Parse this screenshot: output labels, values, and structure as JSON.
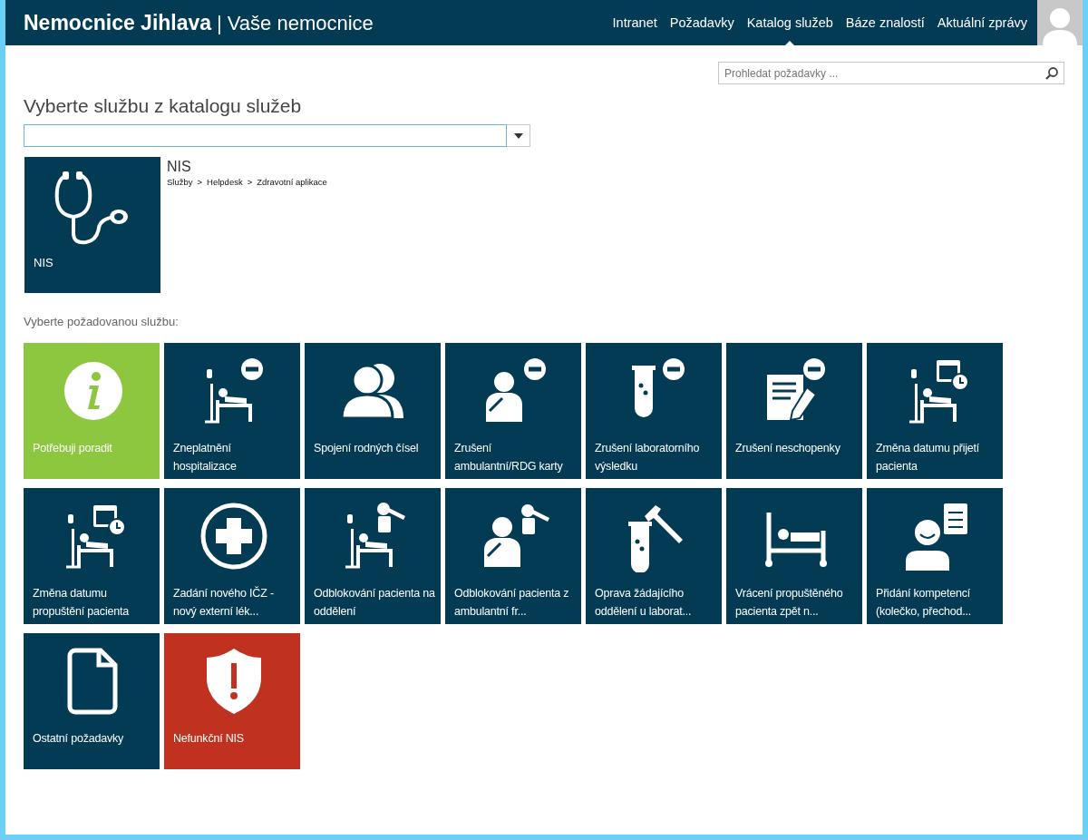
{
  "header": {
    "brand": "Nemocnice Jihlava",
    "separator": "|",
    "tagline": "Vaše nemocnice",
    "nav": [
      {
        "label": "Intranet",
        "selected": false
      },
      {
        "label": "Požadavky",
        "selected": false
      },
      {
        "label": "Katalog služeb",
        "selected": true
      },
      {
        "label": "Báze znalostí",
        "selected": false
      },
      {
        "label": "Aktuální zprávy",
        "selected": false
      }
    ]
  },
  "request_search": {
    "placeholder": "Prohledat požadavky ..."
  },
  "heading": "Vyberte službu z katalogu služeb",
  "selected_service": {
    "tile_label": "NIS",
    "title": "NIS",
    "breadcrumb": [
      "Služby",
      "Helpdesk",
      "Zdravotní aplikace"
    ],
    "separator": ">"
  },
  "services_label": "Vyberte požadovanou službu:",
  "services": [
    {
      "label": "Potřebuji poradit",
      "kind": "info",
      "color": "#8dc63f"
    },
    {
      "label": "Zneplatnění hospitalizace",
      "kind": "bed-minus",
      "color": "#033a54"
    },
    {
      "label": "Spojení rodných čísel",
      "kind": "people",
      "color": "#033a54"
    },
    {
      "label": "Zrušení ambulantní/RDG karty",
      "kind": "patient-minus",
      "color": "#033a54"
    },
    {
      "label": "Zrušení laboratorního výsledku",
      "kind": "tube-minus",
      "color": "#033a54"
    },
    {
      "label": "Zrušení neschopenky",
      "kind": "form-minus",
      "color": "#033a54"
    },
    {
      "label": "Změna datumu přijetí pacienta",
      "kind": "bed-calendar",
      "color": "#033a54"
    },
    {
      "label": "Změna datumu propuštění pacienta",
      "kind": "bed-calendar",
      "color": "#033a54"
    },
    {
      "label": "Zadání nového IČZ - nový externí lék...",
      "kind": "cross",
      "color": "#033a54"
    },
    {
      "label": "Odblokování pacienta na oddělení",
      "kind": "bed-key",
      "color": "#033a54"
    },
    {
      "label": "Odblokování pacienta z ambulantní fr...",
      "kind": "patient-key",
      "color": "#033a54"
    },
    {
      "label": "Oprava žádajícího oddělení u laborat...",
      "kind": "tube-wrench",
      "color": "#033a54"
    },
    {
      "label": "Vrácení propuštěného pacienta zpět n...",
      "kind": "bed",
      "color": "#033a54"
    },
    {
      "label": "Přidání kompetencí (kolečko, přechod...",
      "kind": "person-checklist",
      "color": "#033a54"
    },
    {
      "label": "Ostatní požadavky",
      "kind": "document",
      "color": "#033a54"
    },
    {
      "label": "Nefunkční NIS",
      "kind": "shield",
      "color": "#c0311f"
    }
  ]
}
